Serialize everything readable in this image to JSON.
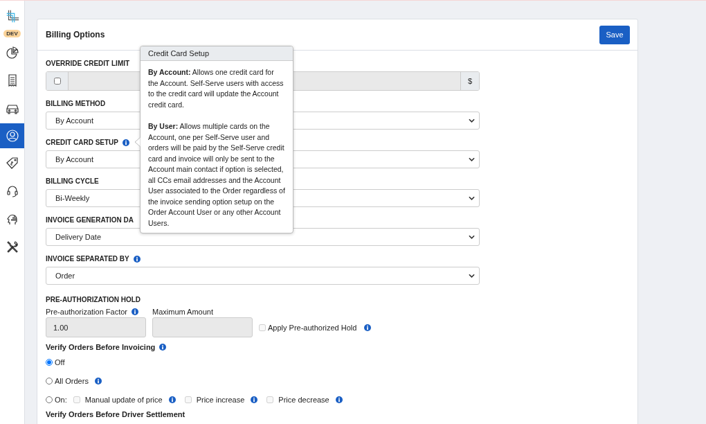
{
  "sidebar": {
    "badge": "DEV",
    "items": [
      {
        "selected": false
      },
      {
        "selected": false
      },
      {
        "selected": false
      },
      {
        "selected": true
      },
      {
        "selected": false
      },
      {
        "selected": false
      },
      {
        "selected": false
      },
      {
        "selected": false
      }
    ]
  },
  "panel": {
    "title": "Billing Options",
    "save_button": "Save",
    "override_credit_limit": {
      "label": "OVERRIDE CREDIT LIMIT",
      "checked": false,
      "addon": "$"
    },
    "selects": [
      {
        "label": "BILLING METHOD",
        "value": "By Account",
        "info": false
      },
      {
        "label": "CREDIT CARD SETUP",
        "value": "By Account",
        "info": true
      },
      {
        "label": "BILLING CYCLE",
        "value": "Bi-Weekly",
        "info": false
      },
      {
        "label": "INVOICE GENERATION DA",
        "value": "Delivery Date",
        "info": false
      },
      {
        "label": "INVOICE SEPARATED BY",
        "value": "Order",
        "info": true
      }
    ],
    "pre_authorization": {
      "heading": "PRE-AUTHORIZATION HOLD",
      "factor_label": "Pre-authorization Factor",
      "factor_value": "1.00",
      "max_label": "Maximum Amount",
      "hold_label": "Apply Pre-authorized Hold",
      "hold_checked": false,
      "hold_disabled": true
    },
    "verify_invoicing": {
      "heading": "Verify Orders Before Invoicing",
      "options": [
        {
          "label": "Off",
          "selected": true,
          "info": false
        },
        {
          "label": "All Orders",
          "selected": false,
          "info": true
        },
        {
          "label": "On:",
          "selected": false,
          "info": false,
          "checks": [
            {
              "label": "Manual update of price",
              "checked": false,
              "disabled": true
            },
            {
              "label": "Price increase",
              "checked": false,
              "disabled": true
            },
            {
              "label": "Price decrease",
              "checked": false,
              "disabled": true
            }
          ]
        }
      ]
    },
    "verify_settlement": {
      "heading": "Verify Orders Before Driver Settlement"
    }
  },
  "tooltip": {
    "title": "Credit Card Setup",
    "paragraphs": [
      "**By Account:** Allows one credit card for the Account. Self-Serve users with access to the credit card will update the Account credit card.",
      "**By User:** Allows multiple cards on the Account, one per Self-Serve user and orders will be paid by the Self-Serve credit card and invoice will only be sent to the Account main contact if option is selected, all CCs email addresses and the Account User associated to the Order regardless of the invoice sending option setup on the Order Account User or any other Account Users."
    ]
  }
}
